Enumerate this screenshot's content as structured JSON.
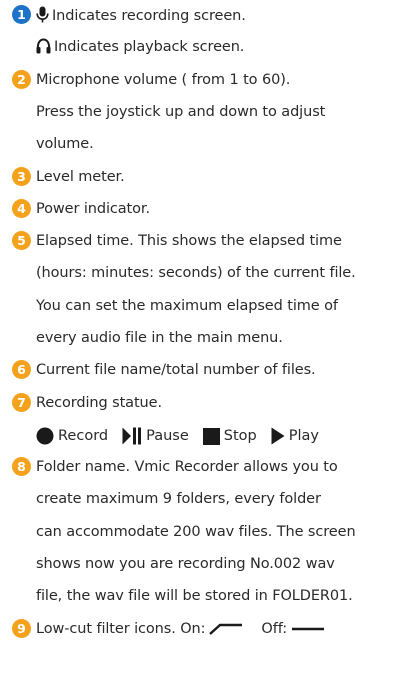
{
  "colors": {
    "badge_primary": "#1e73c8",
    "badge_accent": "#f4a21c",
    "text": "#2a2a2a",
    "icon": "#1a1a1a"
  },
  "items": [
    {
      "number": "1",
      "badge_color": "#1e73c8",
      "lines": [
        {
          "icon": "microphone-icon",
          "text": "Indicates recording screen."
        },
        {
          "icon": "headphones-icon",
          "text": "Indicates playback screen."
        }
      ]
    },
    {
      "number": "2",
      "badge_color": "#f4a21c",
      "lines": [
        {
          "text": "Microphone volume ( from 1 to 60)."
        },
        {
          "text": "Press the joystick up and down to adjust"
        },
        {
          "text": "volume."
        }
      ]
    },
    {
      "number": "3",
      "badge_color": "#f4a21c",
      "lines": [
        {
          "text": "Level meter."
        }
      ]
    },
    {
      "number": "4",
      "badge_color": "#f4a21c",
      "lines": [
        {
          "text": "Power indicator."
        }
      ]
    },
    {
      "number": "5",
      "badge_color": "#f4a21c",
      "lines": [
        {
          "text": "Elapsed time. This shows the elapsed time"
        },
        {
          "text": "(hours: minutes: seconds) of the current file."
        },
        {
          "text": "You can set the maximum elapsed time of"
        },
        {
          "text": "every audio file in the main menu."
        }
      ]
    },
    {
      "number": "6",
      "badge_color": "#f4a21c",
      "lines": [
        {
          "text": "Current file name/total number of files."
        }
      ]
    },
    {
      "number": "7",
      "badge_color": "#f4a21c",
      "lines": [
        {
          "text": "Recording statue."
        }
      ],
      "statuses": [
        {
          "icon": "record-icon",
          "label": "Record"
        },
        {
          "icon": "pause-icon",
          "label": "Pause"
        },
        {
          "icon": "stop-icon",
          "label": "Stop"
        },
        {
          "icon": "play-icon",
          "label": "Play"
        }
      ]
    },
    {
      "number": "8",
      "badge_color": "#f4a21c",
      "lines": [
        {
          "text": "Folder name. Vmic Recorder allows you to"
        },
        {
          "text": "create maximum 9 folders, every folder"
        },
        {
          "text": "can accommodate 200 wav files. The screen"
        },
        {
          "text": "shows now you are recording No.002 wav"
        },
        {
          "text": "file, the wav file will be stored in FOLDER01."
        }
      ]
    },
    {
      "number": "9",
      "badge_color": "#f4a21c",
      "lines": [
        {
          "text": "Low-cut filter icons. On:"
        }
      ],
      "off_label": "Off:"
    }
  ]
}
